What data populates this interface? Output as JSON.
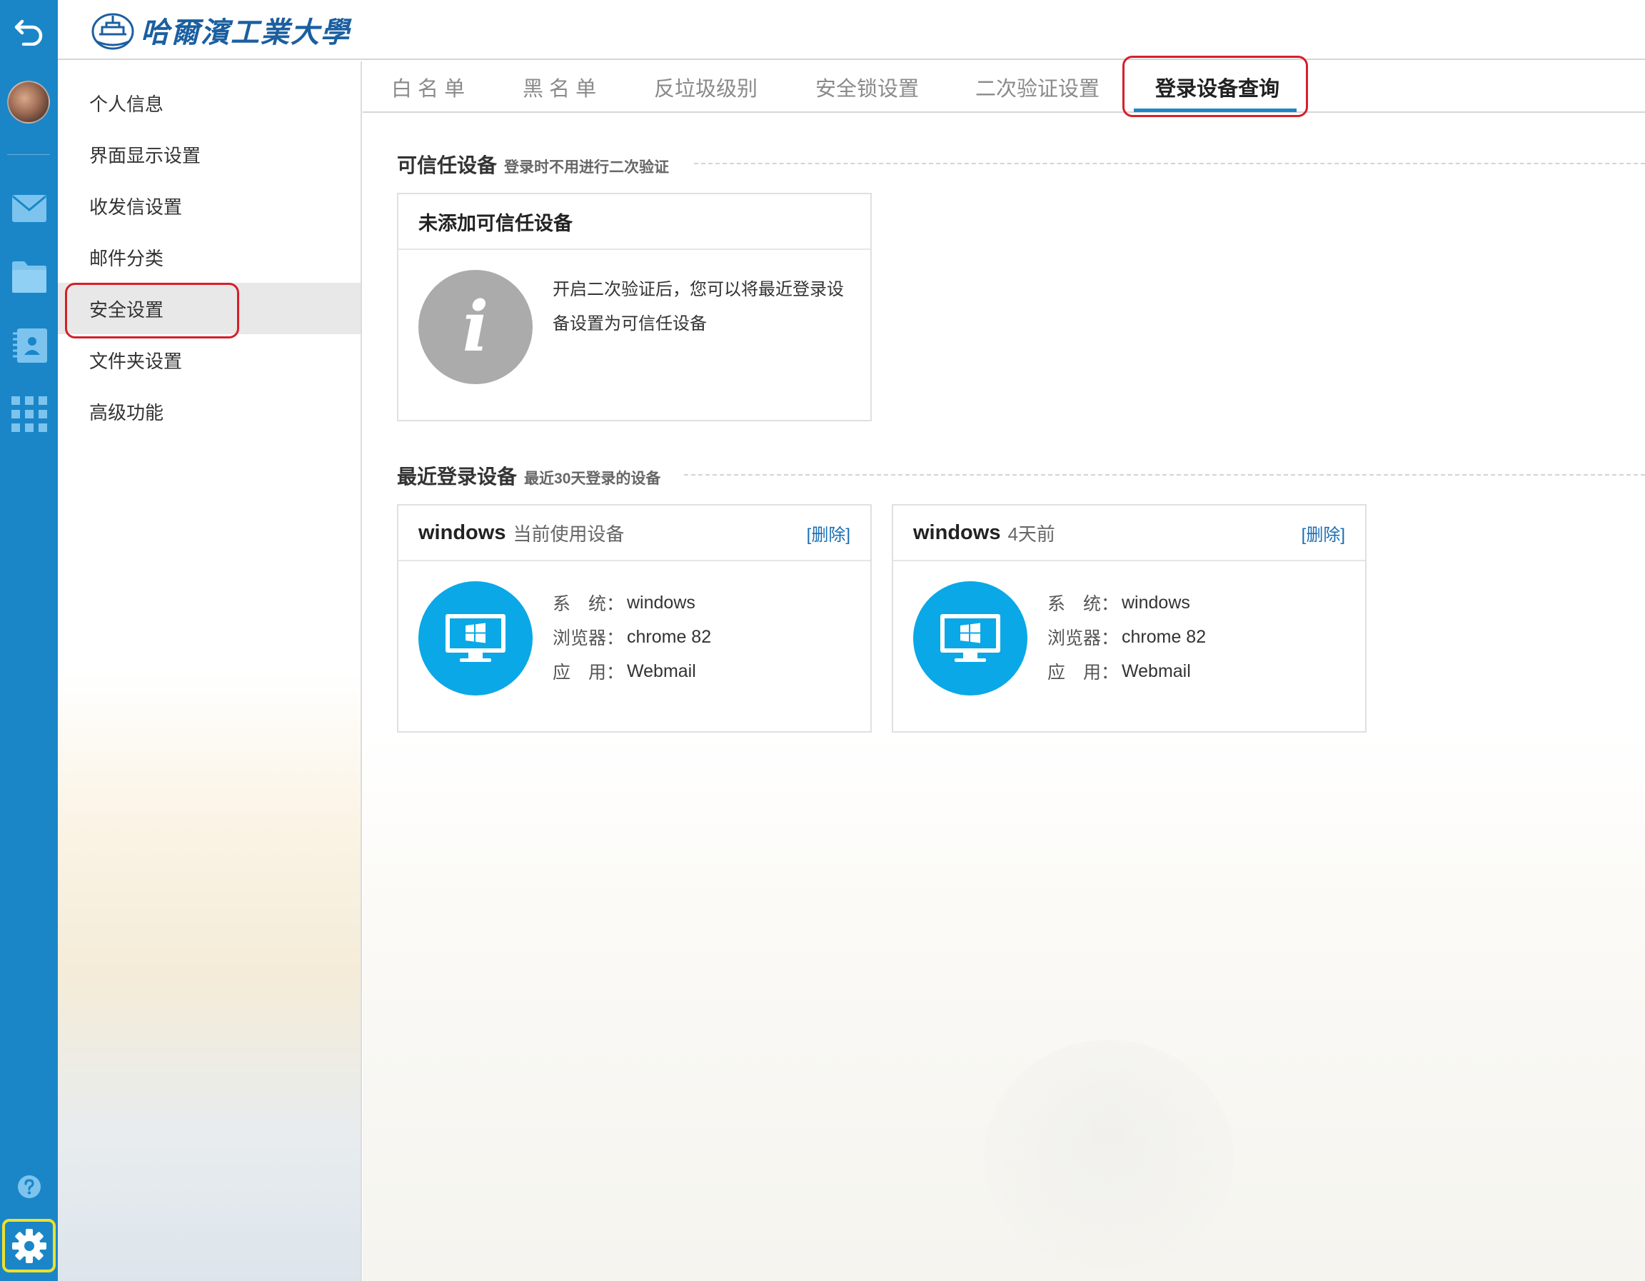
{
  "logo": {
    "text": "哈爾濱工業大學"
  },
  "rail": {
    "icons": [
      "back-icon",
      "avatar",
      "mail-icon",
      "folder-icon",
      "contacts-icon",
      "apps-icon",
      "help-icon",
      "gear-icon"
    ]
  },
  "sidebar": {
    "items": [
      {
        "label": "个人信息"
      },
      {
        "label": "界面显示设置"
      },
      {
        "label": "收发信设置"
      },
      {
        "label": "邮件分类"
      },
      {
        "label": "安全设置",
        "active": true
      },
      {
        "label": "文件夹设置"
      },
      {
        "label": "高级功能"
      }
    ]
  },
  "tabs": [
    {
      "label": "白 名 单"
    },
    {
      "label": "黑 名 单"
    },
    {
      "label": "反垃圾级别"
    },
    {
      "label": "安全锁设置"
    },
    {
      "label": "二次验证设置"
    },
    {
      "label": "登录设备查询",
      "active": true
    }
  ],
  "trusted": {
    "title": "可信任设备",
    "subtitle": "登录时不用进行二次验证",
    "card_title": "未添加可信任设备",
    "info_glyph": "i",
    "description": "开启二次验证后，您可以将最近登录设备设置为可信任设备"
  },
  "recent": {
    "title": "最近登录设备",
    "subtitle": "最近30天登录的设备",
    "labels": {
      "system": "系　统：",
      "browser": "浏览器：",
      "app": "应　用："
    },
    "devices": [
      {
        "name": "windows",
        "status": "当前使用设备",
        "delete": "[删除]",
        "system": "windows",
        "browser": "chrome 82",
        "app": "Webmail"
      },
      {
        "name": "windows",
        "status": "4天前",
        "delete": "[删除]",
        "system": "windows",
        "browser": "chrome 82",
        "app": "Webmail"
      }
    ]
  },
  "colors": {
    "rail": "#1a86c8",
    "accent_blue": "#1a86c8",
    "highlight_red": "#d4202b",
    "highlight_yellow": "#f0e02a",
    "device_icon": "#0aa8e6",
    "info_icon": "#ababab"
  }
}
